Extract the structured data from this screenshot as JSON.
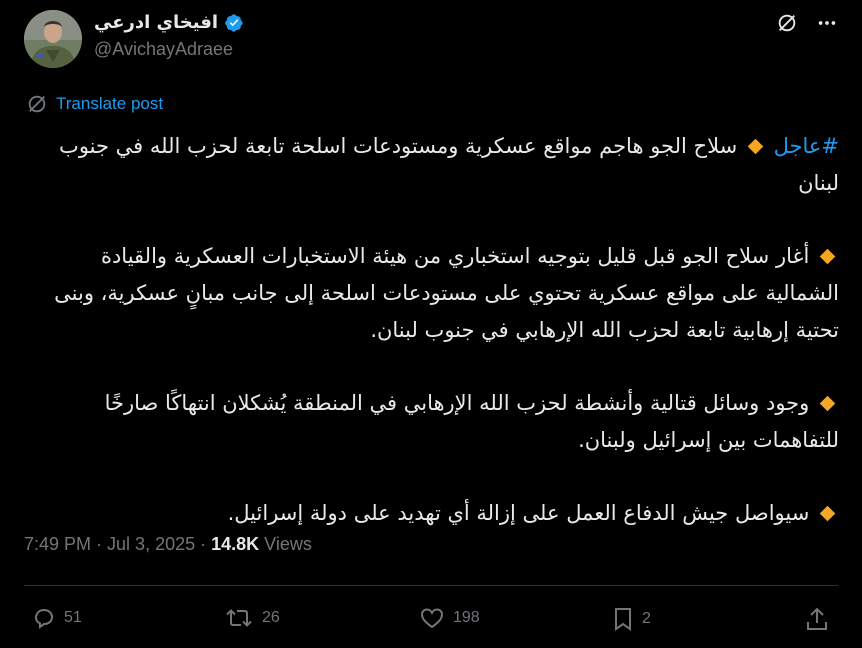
{
  "author": {
    "display_name": "افيخاي ادرعي",
    "handle": "@AvichayAdraee",
    "verified": true
  },
  "header_icons": [
    "grok-icon",
    "more-icon"
  ],
  "translate": {
    "label": "Translate post"
  },
  "post": {
    "paragraphs": [
      {
        "hashtag": "#عاجل",
        "text": "سلاح الجو هاجم مواقع عسكرية ومستودعات اسلحة تابعة لحزب الله في جنوب لبنان"
      },
      {
        "hashtag": "",
        "text": "أغار سلاح الجو قبل قليل بتوجيه استخباري من هيئة الاستخبارات العسكرية والقيادة الشمالية على مواقع عسكرية تحتوي على مستودعات اسلحة إلى جانب مبانٍ عسكرية، وبنى تحتية إرهابية تابعة لحزب الله الإرهابي في جنوب لبنان."
      },
      {
        "hashtag": "",
        "text": "وجود وسائل قتالية وأنشطة لحزب الله الإرهابي في المنطقة يُشكلان انتهاكًا صارخًا للتفاهمات بين إسرائيل ولبنان."
      },
      {
        "hashtag": "",
        "text": "سيواصل جيش الدفاع العمل على إزالة أي تهديد على دولة إسرائيل."
      }
    ]
  },
  "meta": {
    "time": "7:49 PM",
    "separator": "·",
    "date": "Jul 3, 2025",
    "views_count": "14.8K",
    "views_label": "Views"
  },
  "actions": {
    "replies": "51",
    "reposts": "26",
    "likes": "198",
    "bookmarks": "2"
  },
  "colors": {
    "background": "#000000",
    "text": "#e7e9ea",
    "muted": "#71767b",
    "accent": "#1d9bf0",
    "diamond": "#f5a623"
  }
}
